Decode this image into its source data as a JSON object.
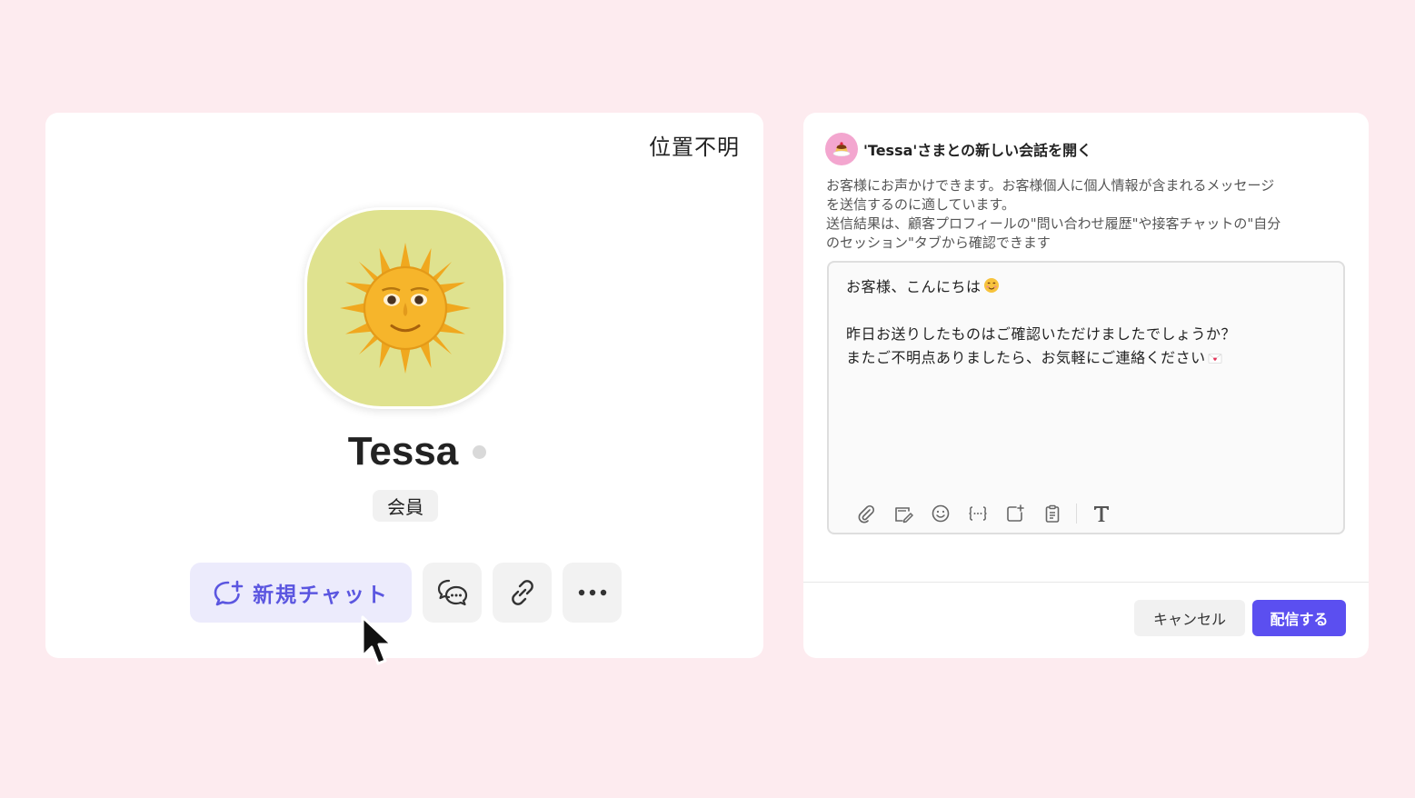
{
  "profile": {
    "location": "位置不明",
    "avatar_icon": "sun-with-face-icon",
    "name": "Tessa",
    "member_tag": "会員",
    "actions": {
      "new_chat_label": "新規チャット",
      "chat_history_icon": "chat-bubbles-icon",
      "link_icon": "link-icon",
      "more_icon": "more-dots-icon"
    },
    "colors": {
      "avatar_bg": "#dfe28f",
      "accent": "#5b56e0"
    }
  },
  "compose": {
    "title": "'Tessa'さまとの新しい会話を開く",
    "description": [
      "お客様にお声かけできます。お客様個人に個人情報が含まれるメッセージ",
      "を送信するのに適しています。",
      "送信結果は、顧客プロフィールの\"問い合わせ履歴\"や接客チャットの\"自分",
      "のセッション\"タブから確認できます"
    ],
    "message": {
      "line1": "お客様、こんにちは",
      "line2": "",
      "line3": "昨日お送りしたものはご確認いただけましたでしょうか？",
      "line4": "またご不明点ありましたら、お気軽にご連絡ください"
    },
    "toolbar": [
      "attachment-icon",
      "template-icon",
      "emoji-icon",
      "variable-icon",
      "add-image-icon",
      "clipboard-icon",
      "text-format-icon"
    ],
    "cancel_label": "キャンセル",
    "send_label": "配信する",
    "colors": {
      "primary": "#5b4ff0"
    }
  }
}
